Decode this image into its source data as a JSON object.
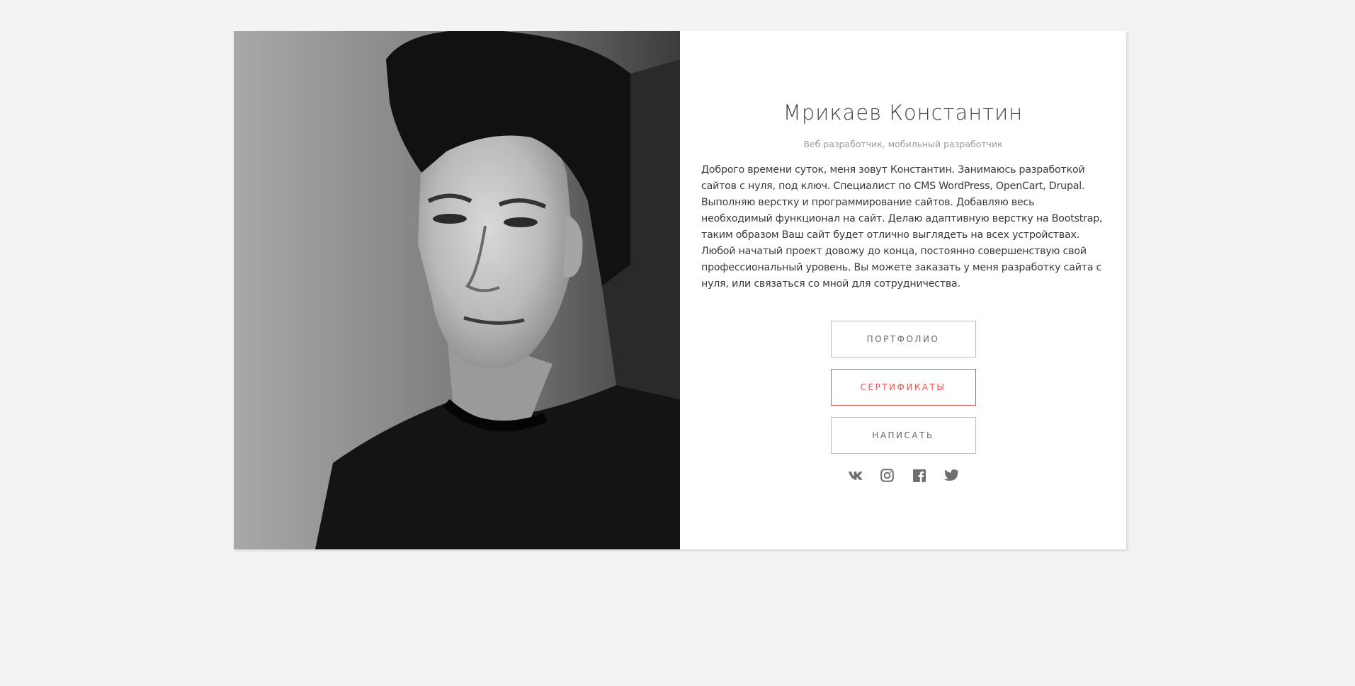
{
  "profile": {
    "name": "Мрикаев Константин",
    "role": "Веб разработчик, мобильный разработчик",
    "bio": "Доброго времени суток, меня зовут Константин. Занимаюсь разработкой сайтов с нуля, под ключ. Специалист по CMS WordPress, OpenCart, Drupal. Выполняю верстку и программирование сайтов. Добавляю весь необходимый функционал на сайт. Делаю адаптивную верстку на Bootstrap, таким образом Ваш сайт будет отлично выглядеть на всех устройствах. Любой начатый проект довожу до конца, постоянно совершенствую свой профессиональный уровень. Вы можете заказать у меня разработку сайта с нуля, или связаться со мной для сотрудничества."
  },
  "buttons": {
    "portfolio": "ПОРТФОЛИО",
    "certificates": "СЕРТИФИКАТЫ",
    "write": "НАПИСАТЬ"
  },
  "socials": [
    {
      "icon": "vk-icon"
    },
    {
      "icon": "instagram-icon"
    },
    {
      "icon": "facebook-icon"
    },
    {
      "icon": "twitter-icon"
    }
  ],
  "colors": {
    "accent": "#e8544f",
    "page_background": "#f3f3f3",
    "card_background": "#ffffff",
    "icon": "#6e6e6e"
  }
}
